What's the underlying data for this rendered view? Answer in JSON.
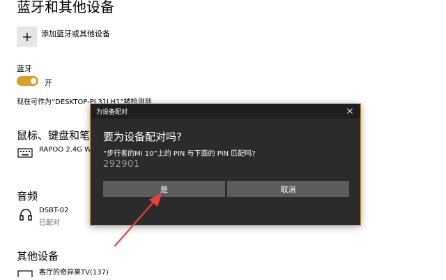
{
  "page": {
    "title": "蓝牙和其他设备",
    "add_device_label": "添加蓝牙或其他设备"
  },
  "bluetooth": {
    "label": "蓝牙",
    "toggle_state": "开",
    "toggle_on": true,
    "discoverable_text": "现在可作为“DESKTOP-PL31LH1”被检测到",
    "accent_color": "#d6a02e"
  },
  "sections": {
    "mouse_keyboard": {
      "title": "鼠标、键盘和笔",
      "device_name": "RAPOO 2.4G Wir",
      "icon": "keyboard-icon"
    },
    "audio": {
      "title": "音频",
      "device_name": "DSBT-02",
      "device_status": "已配对",
      "icon": "headphones-icon"
    },
    "other": {
      "title": "其他设备",
      "device_name": "客厅的奇异果TV(137)",
      "icon": "tv-icon"
    }
  },
  "dialog": {
    "title": "为设备配对",
    "heading": "要为设备配对吗?",
    "message": "“步行者的Mi 10”上的 PIN 与下面的 PIN 匹配吗?",
    "pin": "292901",
    "yes_label": "是",
    "cancel_label": "取消",
    "border_color": "#c8922a"
  },
  "annotation": {
    "arrow_color": "#e8403a"
  }
}
